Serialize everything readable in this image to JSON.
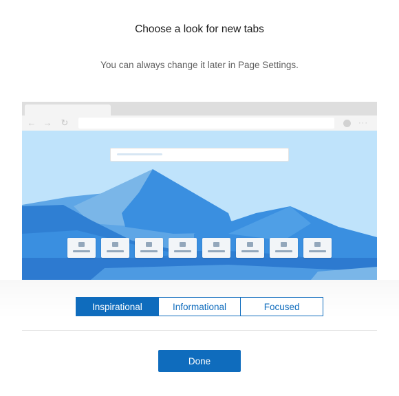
{
  "dialog": {
    "title": "Choose a look for new tabs",
    "subtitle": "You can always change it later in Page Settings."
  },
  "layout_options": {
    "items": [
      {
        "label": "Inspirational",
        "selected": true
      },
      {
        "label": "Informational",
        "selected": false
      },
      {
        "label": "Focused",
        "selected": false
      }
    ]
  },
  "actions": {
    "done_label": "Done"
  },
  "preview": {
    "toolbar_icons": {
      "back": "back-arrow-icon",
      "forward": "forward-arrow-icon",
      "refresh": "refresh-icon",
      "more": "more-ellipsis-icon"
    },
    "quick_link_tile_count": 8
  },
  "colors": {
    "accent": "#0f6cbd",
    "sky": "#bfe3fb",
    "mountain_dark": "#3390e0",
    "mountain_light": "#7ab6e8",
    "water": "#2f7fd3"
  }
}
